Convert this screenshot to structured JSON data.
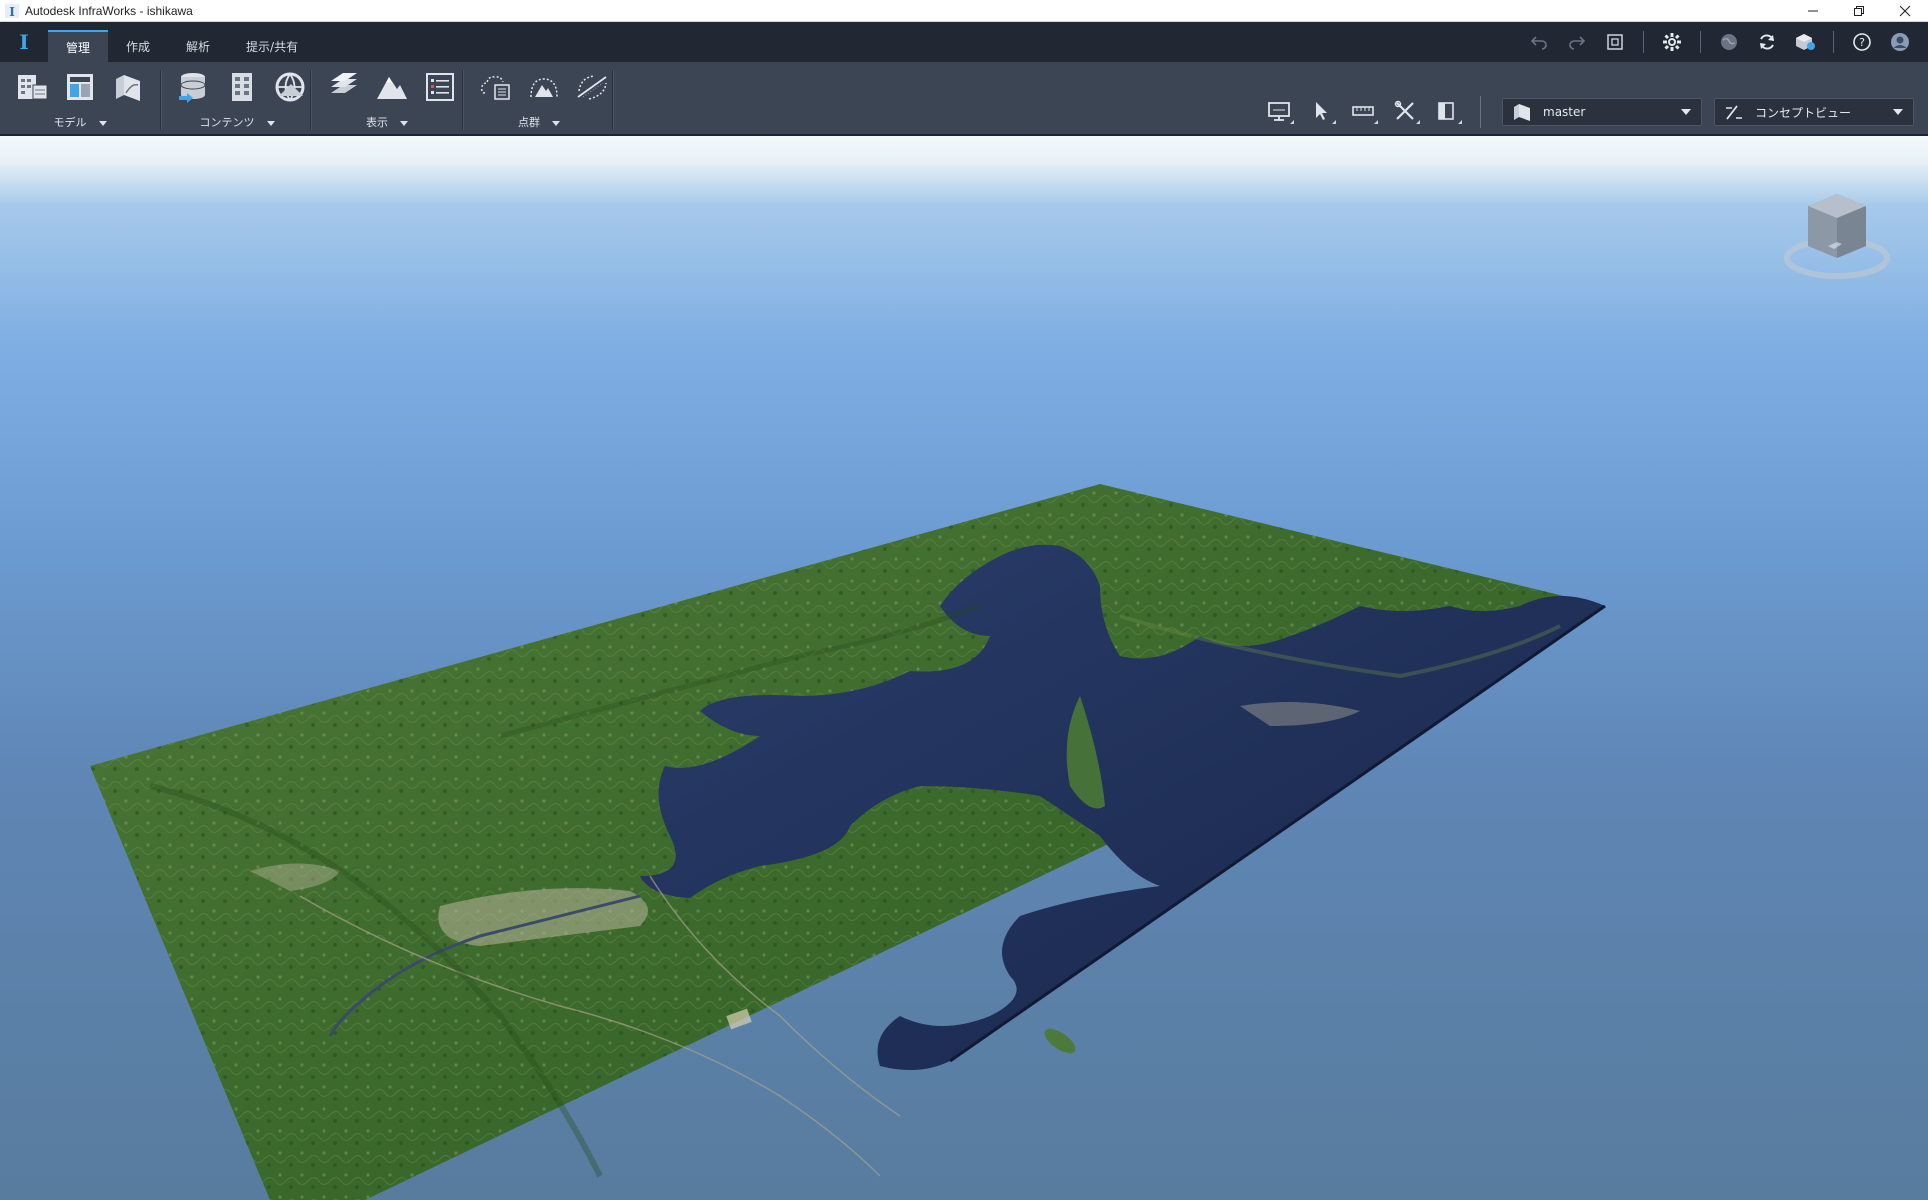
{
  "window": {
    "title": "Autodesk InfraWorks - ishikawa"
  },
  "tabs": [
    {
      "label": "管理",
      "active": true
    },
    {
      "label": "作成",
      "active": false
    },
    {
      "label": "解析",
      "active": false
    },
    {
      "label": "提示/共有",
      "active": false
    }
  ],
  "ribbon": {
    "groups": [
      {
        "label": "モデル"
      },
      {
        "label": "コンテンツ"
      },
      {
        "label": "表示"
      },
      {
        "label": "点群"
      }
    ],
    "proposal_dropdown": {
      "value": "master"
    },
    "view_dropdown": {
      "value": "コンセプトビュー"
    }
  },
  "colors": {
    "accent": "#3fa5e8",
    "ribbon_bg": "#3b4554",
    "tabbar_bg": "#222833",
    "water": "#1f2d55",
    "terrain": "#3c6a2c"
  }
}
